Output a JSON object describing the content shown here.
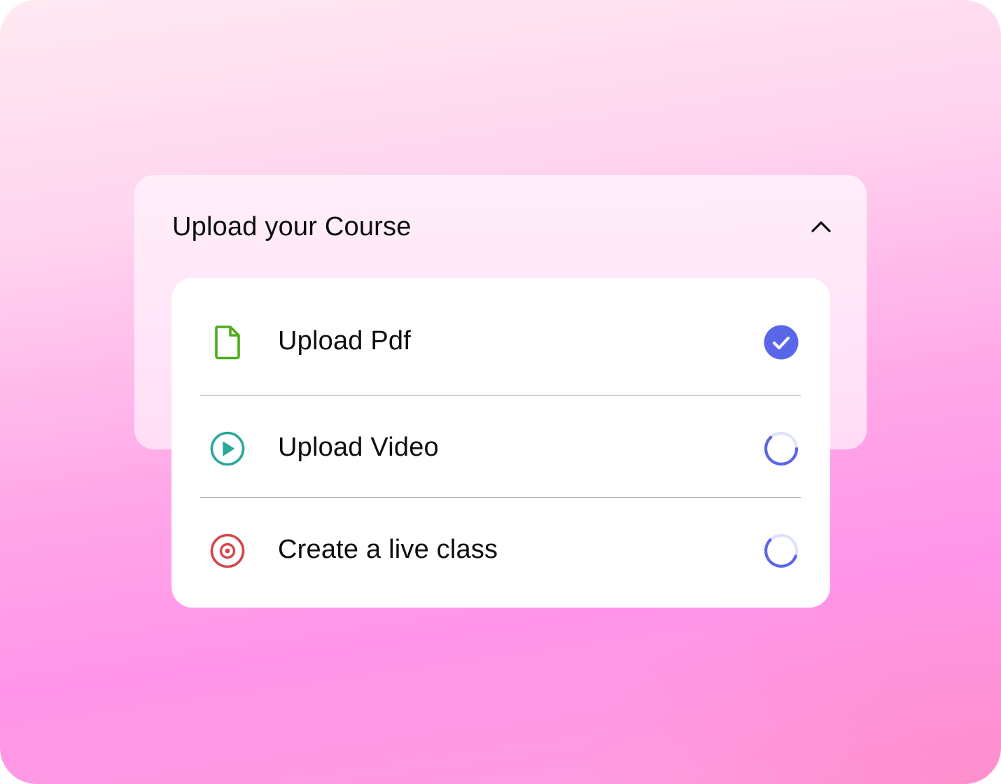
{
  "panel": {
    "title": "Upload your Course",
    "collapse_icon": "chevron-up-icon"
  },
  "items": [
    {
      "label": "Upload Pdf",
      "icon": "file-icon",
      "icon_color": "#4caf1a",
      "status": "completed",
      "status_icon": "check-circle-icon"
    },
    {
      "label": "Upload Video",
      "icon": "play-circle-icon",
      "icon_color": "#2aa898",
      "status": "in-progress",
      "status_icon": "loading-spinner-icon"
    },
    {
      "label": "Create a live class",
      "icon": "live-record-icon",
      "icon_color": "#d4464b",
      "status": "in-progress",
      "status_icon": "loading-spinner-icon"
    }
  ],
  "colors": {
    "accent": "#5a66e8",
    "accent_track": "#dfe2fb"
  }
}
